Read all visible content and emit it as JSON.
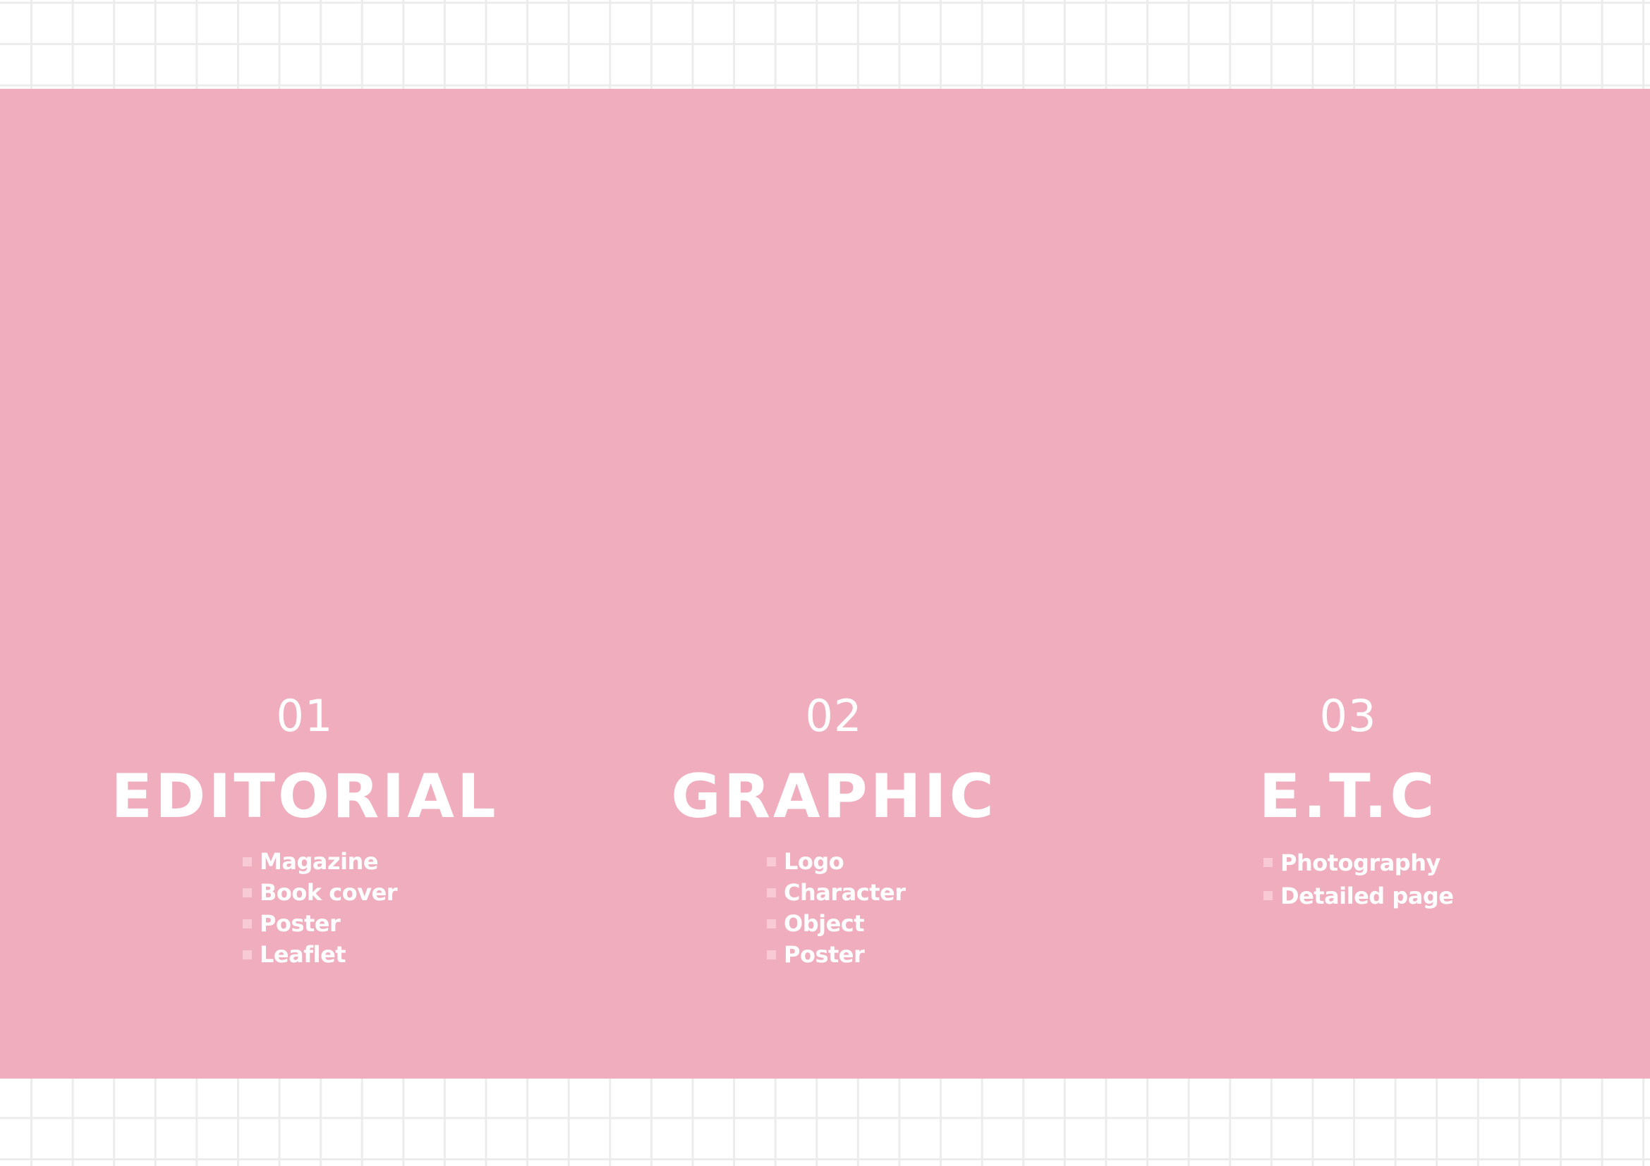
{
  "colors": {
    "band": "#f0adbe",
    "text": "#ffffff",
    "bullet": "#f7cad6",
    "grid": "#ececec"
  },
  "sections": [
    {
      "number": "01",
      "title": "EDITORIAL",
      "items": [
        "Magazine",
        "Book cover",
        "Poster",
        "Leaflet"
      ]
    },
    {
      "number": "02",
      "title": "GRAPHIC",
      "items": [
        "Logo",
        "Character",
        "Object",
        "Poster"
      ]
    },
    {
      "number": "03",
      "title": "E.T.C",
      "items": [
        "Photography",
        "Detailed page"
      ]
    }
  ]
}
